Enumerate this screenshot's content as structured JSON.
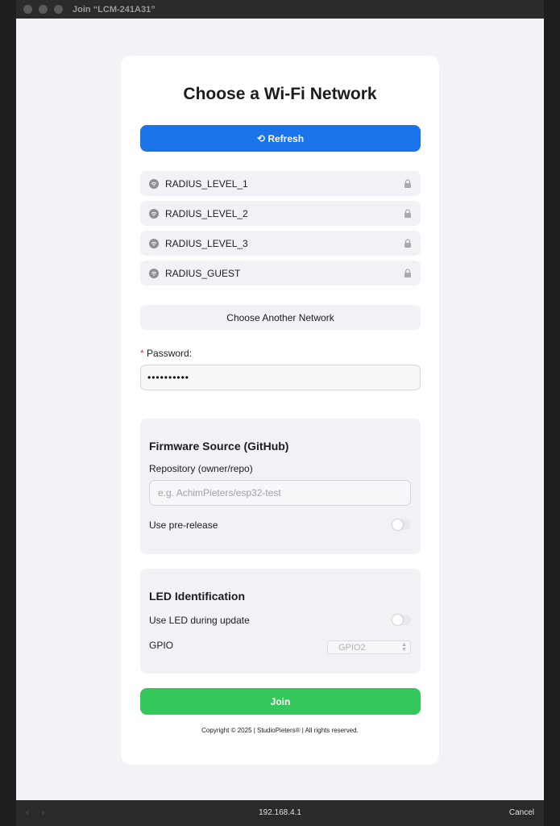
{
  "window": {
    "title": "Join “LCM-241A31”"
  },
  "page": {
    "heading": "Choose a Wi-Fi Network",
    "refresh_label": "⟲ Refresh",
    "networks": [
      {
        "name": "RADIUS_LEVEL_1",
        "secured": true
      },
      {
        "name": "RADIUS_LEVEL_2",
        "secured": true
      },
      {
        "name": "RADIUS_LEVEL_3",
        "secured": true
      },
      {
        "name": "RADIUS_GUEST",
        "secured": true
      }
    ],
    "choose_another_label": "Choose Another Network",
    "password": {
      "required_mark": "*",
      "label": "Password:",
      "value": "••••••••••"
    },
    "firmware": {
      "title": "Firmware Source (GitHub)",
      "repo_label": "Repository (owner/repo)",
      "repo_placeholder": "e.g. AchimPieters/esp32-test",
      "prerelease_label": "Use pre-release",
      "prerelease_enabled": false
    },
    "led": {
      "title": "LED Identification",
      "use_led_label": "Use LED during update",
      "use_led_enabled": false,
      "gpio_label": "GPIO",
      "gpio_selected": "GPIO2"
    },
    "join_label": "Join",
    "copyright": "Copyright © 2025 | StudioPieters® | All rights reserved."
  },
  "browser": {
    "url": "192.168.4.1",
    "cancel_label": "Cancel",
    "back_icon": "‹",
    "forward_icon": "›"
  },
  "colors": {
    "primary": "#1a73e8",
    "join": "#34c759",
    "required": "#e53935"
  }
}
